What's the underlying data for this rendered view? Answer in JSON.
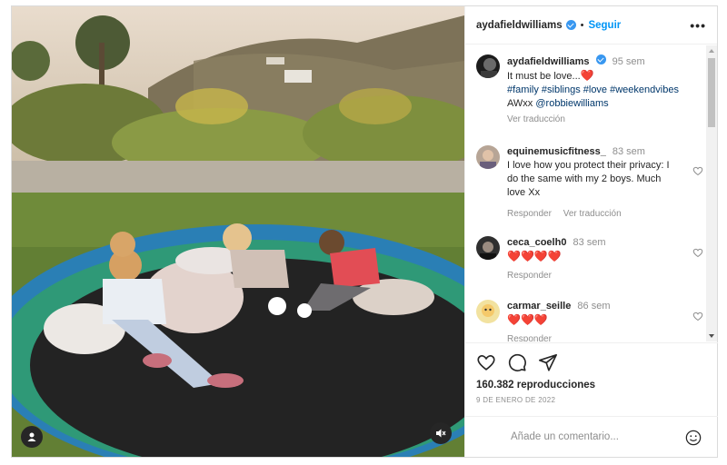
{
  "post": {
    "username": "aydafieldwilliams",
    "follow_label": "Seguir",
    "dot": "•",
    "more_icon": "more-horizontal-icon"
  },
  "caption": {
    "username": "aydafieldwilliams",
    "time": "95 sem",
    "line1": "It must be love...",
    "line1_emoji": "❤️",
    "hashtags": "#family #siblings #love #weekendvibes",
    "line3_prefix": "AWxx ",
    "mention": "@robbiewilliams",
    "translate": "Ver traducción"
  },
  "comments": [
    {
      "username": "equinemusicfitness_",
      "time": "83 sem",
      "text": "I love how you protect their privacy: I do the same with my 2 boys. Much love Xx",
      "reply": "Responder",
      "translate": "Ver traducción"
    },
    {
      "username": "ceca_coelh0",
      "time": "83 sem",
      "text": "❤️❤️❤️❤️",
      "reply": "Responder"
    },
    {
      "username": "carmar_seille",
      "time": "86 sem",
      "text": "❤️❤️❤️",
      "reply": "Responder"
    }
  ],
  "stats": {
    "views": "160.382 reproducciones",
    "date": "9 DE ENERO DE 2022"
  },
  "composer": {
    "placeholder": "Añade un comentario..."
  },
  "colors": {
    "accent": "#0095f6",
    "link": "#00376b",
    "secondary_text": "#8e8e8e",
    "heart": "#ed1c24"
  }
}
